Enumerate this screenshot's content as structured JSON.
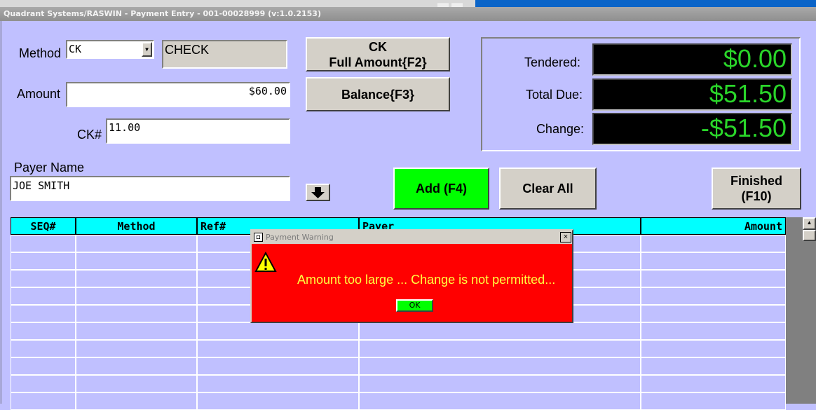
{
  "window": {
    "title": "Quadrant Systems/RASWIN - Payment Entry - 001-00028999 (v:1.0.2153)"
  },
  "form": {
    "method_label": "Method",
    "method_value": "CK",
    "method_description": "CHECK",
    "amount_label": "Amount",
    "amount_value": "$60.00",
    "ck_label": "CK#",
    "ck_value": "11.00",
    "payer_label": "Payer Name",
    "payer_value": "JOE SMITH"
  },
  "buttons": {
    "full_amount_line1": "CK",
    "full_amount_line2": "Full Amount{F2}",
    "balance": "Balance{F3}",
    "add": "Add (F4)",
    "clear_all": "Clear All",
    "finished_line1": "Finished",
    "finished_line2": "(F10)"
  },
  "totals": {
    "tendered_label": "Tendered:",
    "tendered_value": "$0.00",
    "total_due_label": "Total Due:",
    "total_due_value": "$51.50",
    "change_label": "Change:",
    "change_value": "-$51.50"
  },
  "grid": {
    "columns": [
      "SEQ#",
      "Method",
      "Ref#",
      "Payer",
      "Amount"
    ]
  },
  "dialog": {
    "title": "Payment Warning",
    "message": "Amount too large ... Change is not permitted...",
    "ok_label": "OK",
    "close_glyph": "×"
  },
  "colors": {
    "background": "#c0c0ff",
    "grid_header": "#00ffff",
    "add_button": "#00ff00",
    "dialog_bg": "#ff0000",
    "dialog_text": "#ffff40",
    "led_text": "#2ad62a"
  }
}
